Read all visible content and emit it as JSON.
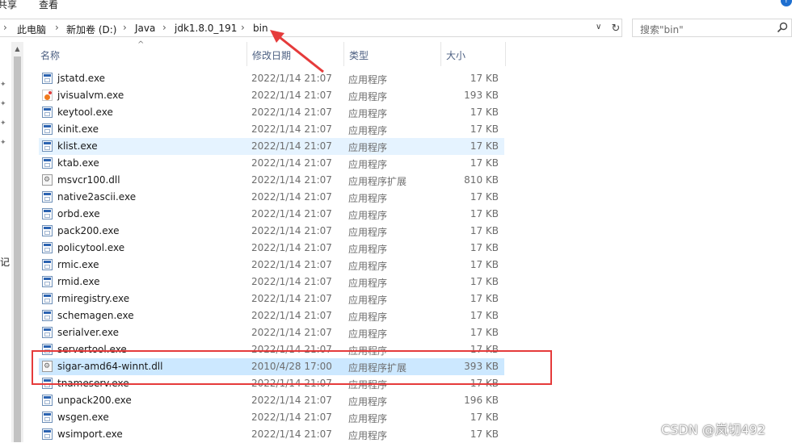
{
  "ribbon": {
    "tabs": [
      "共享",
      "查看"
    ]
  },
  "address": {
    "crumbs": [
      "此电脑",
      "新加卷 (D:)",
      "Java",
      "jdk1.8.0_191",
      "bin"
    ],
    "separator": "›"
  },
  "search": {
    "placeholder": "搜索\"bin\""
  },
  "nav": {
    "cut_text": "记"
  },
  "columns": {
    "name": "名称",
    "date": "修改日期",
    "type": "类型",
    "size": "大小"
  },
  "files": [
    {
      "name": "jstatd.exe",
      "date": "2022/1/14 21:07",
      "type": "应用程序",
      "size": "17 KB",
      "icon": "exe"
    },
    {
      "name": "jvisualvm.exe",
      "date": "2022/1/14 21:07",
      "type": "应用程序",
      "size": "193 KB",
      "icon": "jvisualvm"
    },
    {
      "name": "keytool.exe",
      "date": "2022/1/14 21:07",
      "type": "应用程序",
      "size": "17 KB",
      "icon": "exe"
    },
    {
      "name": "kinit.exe",
      "date": "2022/1/14 21:07",
      "type": "应用程序",
      "size": "17 KB",
      "icon": "exe"
    },
    {
      "name": "klist.exe",
      "date": "2022/1/14 21:07",
      "type": "应用程序",
      "size": "17 KB",
      "icon": "exe"
    },
    {
      "name": "ktab.exe",
      "date": "2022/1/14 21:07",
      "type": "应用程序",
      "size": "17 KB",
      "icon": "exe"
    },
    {
      "name": "msvcr100.dll",
      "date": "2022/1/14 21:07",
      "type": "应用程序扩展",
      "size": "810 KB",
      "icon": "dll"
    },
    {
      "name": "native2ascii.exe",
      "date": "2022/1/14 21:07",
      "type": "应用程序",
      "size": "17 KB",
      "icon": "exe"
    },
    {
      "name": "orbd.exe",
      "date": "2022/1/14 21:07",
      "type": "应用程序",
      "size": "17 KB",
      "icon": "exe"
    },
    {
      "name": "pack200.exe",
      "date": "2022/1/14 21:07",
      "type": "应用程序",
      "size": "17 KB",
      "icon": "exe"
    },
    {
      "name": "policytool.exe",
      "date": "2022/1/14 21:07",
      "type": "应用程序",
      "size": "17 KB",
      "icon": "exe"
    },
    {
      "name": "rmic.exe",
      "date": "2022/1/14 21:07",
      "type": "应用程序",
      "size": "17 KB",
      "icon": "exe"
    },
    {
      "name": "rmid.exe",
      "date": "2022/1/14 21:07",
      "type": "应用程序",
      "size": "17 KB",
      "icon": "exe"
    },
    {
      "name": "rmiregistry.exe",
      "date": "2022/1/14 21:07",
      "type": "应用程序",
      "size": "17 KB",
      "icon": "exe"
    },
    {
      "name": "schemagen.exe",
      "date": "2022/1/14 21:07",
      "type": "应用程序",
      "size": "17 KB",
      "icon": "exe"
    },
    {
      "name": "serialver.exe",
      "date": "2022/1/14 21:07",
      "type": "应用程序",
      "size": "17 KB",
      "icon": "exe"
    },
    {
      "name": "servertool.exe",
      "date": "2022/1/14 21:07",
      "type": "应用程序",
      "size": "17 KB",
      "icon": "exe"
    },
    {
      "name": "sigar-amd64-winnt.dll",
      "date": "2010/4/28 17:00",
      "type": "应用程序扩展",
      "size": "393 KB",
      "icon": "dll",
      "selected": true
    },
    {
      "name": "tnameserv.exe",
      "date": "2022/1/14 21:07",
      "type": "应用程序",
      "size": "17 KB",
      "icon": "exe"
    },
    {
      "name": "unpack200.exe",
      "date": "2022/1/14 21:07",
      "type": "应用程序",
      "size": "196 KB",
      "icon": "exe"
    },
    {
      "name": "wsgen.exe",
      "date": "2022/1/14 21:07",
      "type": "应用程序",
      "size": "17 KB",
      "icon": "exe"
    },
    {
      "name": "wsimport.exe",
      "date": "2022/1/14 21:07",
      "type": "应用程序",
      "size": "17 KB",
      "icon": "exe"
    }
  ],
  "hover_index": 4,
  "colors": {
    "selection": "#cce8ff",
    "hover": "#e5f3ff",
    "annotation": "#e53b3b"
  },
  "watermark": "CSDN @岚切492"
}
